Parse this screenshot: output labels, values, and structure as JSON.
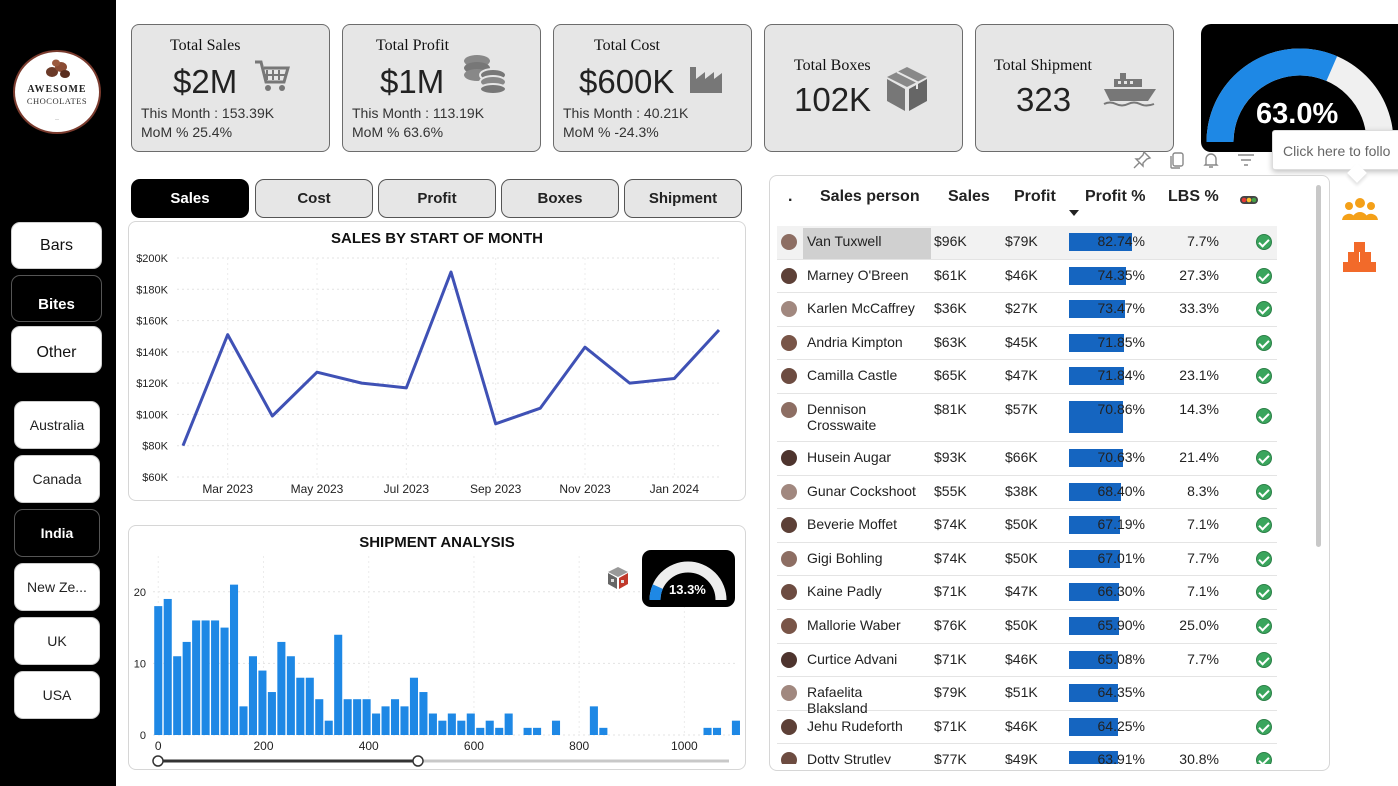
{
  "brand": {
    "line1": "AWESOME",
    "line2": "CHOCOLATES"
  },
  "sidebar": {
    "modes": [
      {
        "label": "Bars",
        "active": false
      },
      {
        "label": "Bites",
        "active": true
      },
      {
        "label": "Other",
        "active": false
      }
    ],
    "countries": [
      {
        "label": "Australia",
        "active": false
      },
      {
        "label": "Canada",
        "active": false
      },
      {
        "label": "India",
        "active": true
      },
      {
        "label": "New Ze...",
        "active": false
      },
      {
        "label": "UK",
        "active": false
      },
      {
        "label": "USA",
        "active": false
      }
    ]
  },
  "kpis": [
    {
      "title": "Total Sales",
      "value": "$2M",
      "this_month": "This Month : 153.39K",
      "mom": "MoM % 25.4%",
      "icon": "cart-icon"
    },
    {
      "title": "Total Profit",
      "value": "$1M",
      "this_month": "This Month : 113.19K",
      "mom": "MoM % 63.6%",
      "icon": "coins-icon"
    },
    {
      "title": "Total Cost",
      "value": "$600K",
      "this_month": "This Month : 40.21K",
      "mom": "MoM % -24.3%",
      "icon": "factory-icon"
    },
    {
      "title": "Total Boxes",
      "value": "102K",
      "icon": "box-icon"
    },
    {
      "title": "Total Shipment",
      "value": "323",
      "icon": "ship-icon"
    }
  ],
  "gauge": {
    "value_label": "63.0%",
    "value": 0.63,
    "color": "#1e88e5",
    "track": "#f0f0f0"
  },
  "tooltip": {
    "text": "Click here to follo"
  },
  "tabs": [
    "Sales",
    "Cost",
    "Profit",
    "Boxes",
    "Shipment"
  ],
  "active_tab": "Sales",
  "colors": {
    "line": "#3f51b5",
    "bars": "#1e88e5",
    "profit_bar": "#1565c0",
    "ok": "#3aa55d",
    "accent_orange": "#f4a018"
  },
  "chart_data": [
    {
      "type": "line",
      "title": "SALES BY START OF MONTH",
      "x": [
        "Feb 2023",
        "Mar 2023",
        "Apr 2023",
        "May 2023",
        "Jun 2023",
        "Jul 2023",
        "Aug 2023",
        "Sep 2023",
        "Oct 2023",
        "Nov 2023",
        "Dec 2023",
        "Jan 2024",
        "Feb 2024"
      ],
      "x_tick_labels": [
        "Mar 2023",
        "May 2023",
        "Jul 2023",
        "Sep 2023",
        "Nov 2023",
        "Jan 2024"
      ],
      "values": [
        80000,
        151000,
        99000,
        127000,
        120000,
        117000,
        191000,
        94000,
        104000,
        143000,
        120000,
        123000,
        154000
      ],
      "y_tick_labels": [
        "$200K",
        "$180K",
        "$160K",
        "$140K",
        "$120K",
        "$100K",
        "$80K",
        "$60K"
      ],
      "ylim": [
        60000,
        200000
      ],
      "grid": true
    },
    {
      "type": "bar",
      "title": "SHIPMENT ANALYSIS",
      "x": [
        0,
        18,
        36,
        54,
        72,
        90,
        108,
        126,
        144,
        162,
        180,
        198,
        216,
        234,
        252,
        270,
        288,
        306,
        324,
        342,
        360,
        378,
        396,
        414,
        432,
        450,
        468,
        486,
        504,
        522,
        540,
        558,
        576,
        594,
        612,
        630,
        648,
        666,
        684,
        702,
        720,
        738,
        756,
        774,
        792,
        810,
        828,
        846,
        864,
        882,
        900,
        918,
        936,
        954,
        972,
        990,
        1008,
        1026,
        1044,
        1062,
        1080,
        1098
      ],
      "values": [
        18,
        19,
        11,
        13,
        16,
        16,
        16,
        15,
        21,
        4,
        11,
        9,
        6,
        13,
        11,
        8,
        8,
        5,
        2,
        14,
        5,
        5,
        5,
        3,
        4,
        5,
        4,
        8,
        6,
        3,
        2,
        3,
        2,
        3,
        1,
        2,
        1,
        3,
        0,
        1,
        1,
        0,
        2,
        0,
        0,
        0,
        4,
        1,
        0,
        0,
        0,
        0,
        0,
        0,
        0,
        0,
        0,
        0,
        1,
        1,
        0,
        2
      ],
      "x_tick_labels": [
        "0",
        "200",
        "400",
        "600",
        "800",
        "1000"
      ],
      "y_tick_labels": [
        "20",
        "10",
        "0"
      ],
      "ylim": [
        0,
        25
      ],
      "xlim": [
        -10,
        1100
      ],
      "grid": true,
      "mini_gauge": {
        "value_label": "13.3%",
        "value": 0.133
      }
    }
  ],
  "table": {
    "headers": [
      ".",
      "Sales person",
      "Sales",
      "Profit",
      "Profit %",
      "LBS %"
    ],
    "rows": [
      {
        "name": "Van Tuxwell",
        "sales": "$96K",
        "profit": "$79K",
        "profit_pct": "82.74%",
        "pct": 0.8274,
        "lbs": "7.7%",
        "selected": true
      },
      {
        "name": "Marney O'Breen",
        "sales": "$61K",
        "profit": "$46K",
        "profit_pct": "74.35%",
        "pct": 0.7435,
        "lbs": "27.3%"
      },
      {
        "name": "Karlen McCaffrey",
        "sales": "$36K",
        "profit": "$27K",
        "profit_pct": "73.47%",
        "pct": 0.7347,
        "lbs": "33.3%"
      },
      {
        "name": "Andria Kimpton",
        "sales": "$63K",
        "profit": "$45K",
        "profit_pct": "71.85%",
        "pct": 0.7185,
        "lbs": ""
      },
      {
        "name": "Camilla Castle",
        "sales": "$65K",
        "profit": "$47K",
        "profit_pct": "71.84%",
        "pct": 0.7184,
        "lbs": "23.1%"
      },
      {
        "name": "Dennison Crosswaite",
        "sales": "$81K",
        "profit": "$57K",
        "profit_pct": "70.86%",
        "pct": 0.7086,
        "lbs": "14.3%",
        "tall": true
      },
      {
        "name": "Husein Augar",
        "sales": "$93K",
        "profit": "$66K",
        "profit_pct": "70.63%",
        "pct": 0.7063,
        "lbs": "21.4%"
      },
      {
        "name": "Gunar Cockshoot",
        "sales": "$55K",
        "profit": "$38K",
        "profit_pct": "68.40%",
        "pct": 0.684,
        "lbs": "8.3%"
      },
      {
        "name": "Beverie Moffet",
        "sales": "$74K",
        "profit": "$50K",
        "profit_pct": "67.19%",
        "pct": 0.6719,
        "lbs": "7.1%"
      },
      {
        "name": "Gigi Bohling",
        "sales": "$74K",
        "profit": "$50K",
        "profit_pct": "67.01%",
        "pct": 0.6701,
        "lbs": "7.7%"
      },
      {
        "name": "Kaine Padly",
        "sales": "$71K",
        "profit": "$47K",
        "profit_pct": "66.30%",
        "pct": 0.663,
        "lbs": "7.1%"
      },
      {
        "name": "Mallorie Waber",
        "sales": "$76K",
        "profit": "$50K",
        "profit_pct": "65.90%",
        "pct": 0.659,
        "lbs": "25.0%"
      },
      {
        "name": "Curtice Advani",
        "sales": "$71K",
        "profit": "$46K",
        "profit_pct": "65.08%",
        "pct": 0.6508,
        "lbs": "7.7%"
      },
      {
        "name": "Rafaelita Blaksland",
        "sales": "$79K",
        "profit": "$51K",
        "profit_pct": "64.35%",
        "pct": 0.6435,
        "lbs": ""
      },
      {
        "name": "Jehu Rudeforth",
        "sales": "$71K",
        "profit": "$46K",
        "profit_pct": "64.25%",
        "pct": 0.6425,
        "lbs": ""
      },
      {
        "name": "Dotty Strutley",
        "sales": "$77K",
        "profit": "$49K",
        "profit_pct": "63.91%",
        "pct": 0.6391,
        "lbs": "30.8%"
      }
    ]
  }
}
